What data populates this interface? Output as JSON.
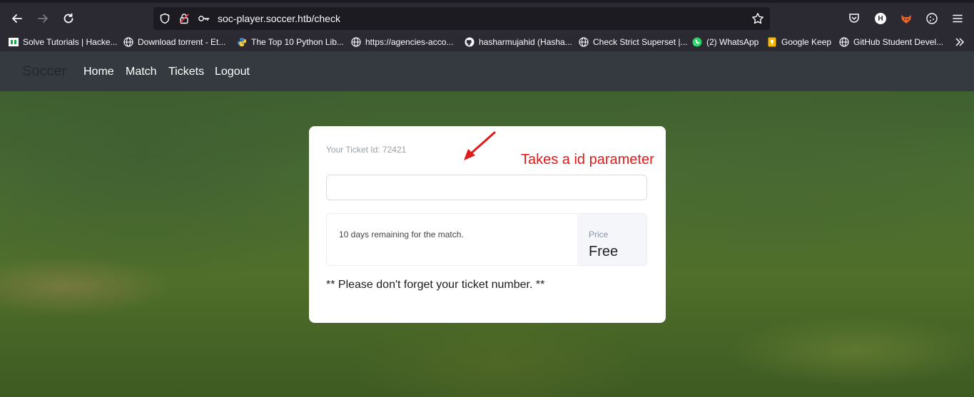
{
  "browser": {
    "url": "soc-player.soccer.htb/check",
    "bookmarks": [
      {
        "label": "Solve Tutorials | Hacke...",
        "icon": "hackerrank-icon"
      },
      {
        "label": "Download torrent - Et...",
        "icon": "globe-icon"
      },
      {
        "label": "The Top 10 Python Lib...",
        "icon": "python-icon"
      },
      {
        "label": "https://agencies-acco...",
        "icon": "globe-icon"
      },
      {
        "label": "hasharmujahid (Hasha...",
        "icon": "github-icon"
      },
      {
        "label": "Check Strict Superset |...",
        "icon": "globe-icon"
      },
      {
        "label": "(2) WhatsApp",
        "icon": "whatsapp-icon"
      },
      {
        "label": "Google Keep",
        "icon": "keep-icon"
      },
      {
        "label": "GitHub Student Devel...",
        "icon": "globe-icon"
      }
    ],
    "profile_initial": "H"
  },
  "navbar": {
    "brand": "Soccer",
    "links": [
      "Home",
      "Match",
      "Tickets",
      "Logout"
    ]
  },
  "card": {
    "ticket_id_label": "Your Ticket Id: 72421",
    "ticket_input_value": "",
    "remaining_text": "10 days remaining for the match.",
    "price_label": "Price",
    "price_value": "Free",
    "note": "** Please don't forget your ticket number. **"
  },
  "annotation": {
    "text": "Takes a id parameter",
    "color": "#e11b1b"
  },
  "colors": {
    "browser_bg": "#2b2a33",
    "navbar_bg": "#343a40"
  }
}
